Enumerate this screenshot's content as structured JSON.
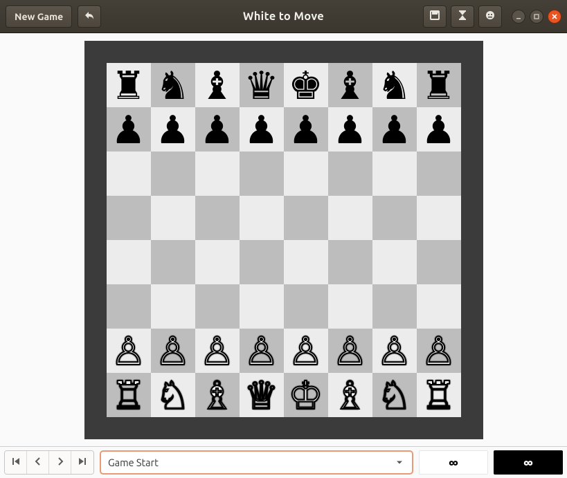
{
  "header": {
    "new_game_label": "New Game",
    "title": "White to Move"
  },
  "board": {
    "rows": [
      [
        "br",
        "bn",
        "bb",
        "bq",
        "bk",
        "bb",
        "bn",
        "br"
      ],
      [
        "bp",
        "bp",
        "bp",
        "bp",
        "bp",
        "bp",
        "bp",
        "bp"
      ],
      [
        "",
        "",
        "",
        "",
        "",
        "",
        "",
        ""
      ],
      [
        "",
        "",
        "",
        "",
        "",
        "",
        "",
        ""
      ],
      [
        "",
        "",
        "",
        "",
        "",
        "",
        "",
        ""
      ],
      [
        "",
        "",
        "",
        "",
        "",
        "",
        "",
        ""
      ],
      [
        "wp",
        "wp",
        "wp",
        "wp",
        "wp",
        "wp",
        "wp",
        "wp"
      ],
      [
        "wr",
        "wn",
        "wb",
        "wq",
        "wk",
        "wb",
        "wn",
        "wr"
      ]
    ]
  },
  "pieces": {
    "wk": "♔",
    "wq": "♕",
    "wr": "♖",
    "wb": "♗",
    "wn": "♘",
    "wp": "♙",
    "bk": "♚",
    "bq": "♛",
    "br": "♜",
    "bb": "♝",
    "bn": "♞",
    "bp": "♟"
  },
  "bottom": {
    "move_label": "Game Start",
    "clock_white": "∞",
    "clock_black": "∞"
  }
}
